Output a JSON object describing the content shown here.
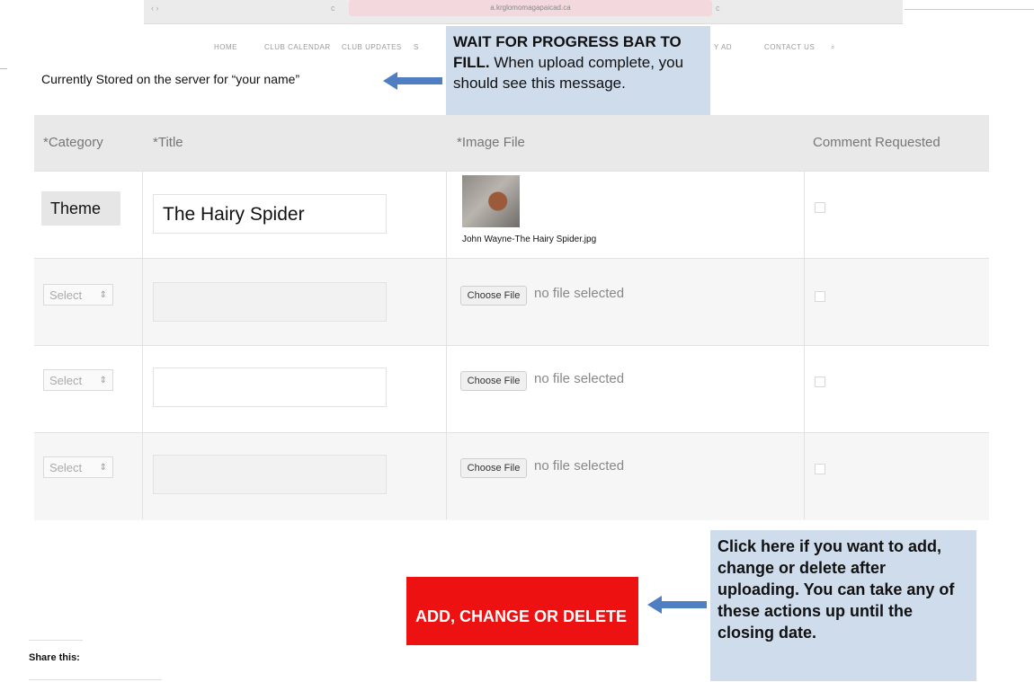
{
  "browser": {
    "url": "a.krglomomagapaicad.ca",
    "nav_glyphs": "‹  ›",
    "tab_glyph": "c",
    "right_glyph": "c"
  },
  "site_nav": {
    "items": [
      "HOME",
      "CLUB CALENDAR",
      "CLUB UPDATES",
      "S",
      "Y AD",
      "CONTACT US",
      "⌕"
    ]
  },
  "stored_line": "Currently Stored on the server for “your name”",
  "callout_top": {
    "bold": "WAIT FOR PROGRESS BAR TO FILL.",
    "normal": " When upload complete, you should see this message."
  },
  "table": {
    "headers": [
      "*Category",
      "*Title",
      "*Image File",
      "Comment Requested"
    ],
    "rows": [
      {
        "category": "Theme",
        "title": "The Hairy Spider",
        "file": "John Wayne-The Hairy Spider.jpg"
      },
      {
        "category": "Select",
        "choose_label": "Choose File",
        "no_file": "no file selected"
      },
      {
        "category": "Select",
        "choose_label": "Choose File",
        "no_file": "no file selected"
      },
      {
        "category": "Select",
        "choose_label": "Choose File",
        "no_file": "no file selected"
      }
    ]
  },
  "action_button": "ADD, CHANGE OR DELETE",
  "callout_bottom": "Click here if you want to add, change or delete after uploading.  You can take any of these actions up until the closing date.",
  "share_label": "Share this:",
  "colors": {
    "callout_bg": "#cfdcec",
    "arrow": "#4f7ec2",
    "action_red": "#ee1111",
    "header_bg": "#e9e9e9"
  }
}
